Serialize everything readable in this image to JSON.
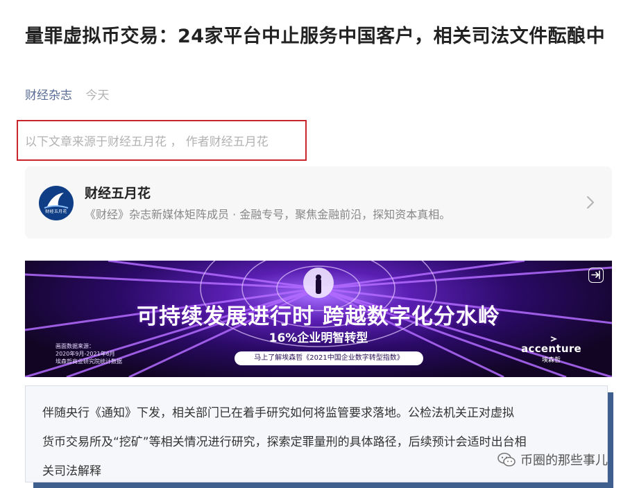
{
  "article": {
    "title": "量罪虚拟币交易：24家平台中止服务中国客户，相关司法文件酝酿中",
    "source": "财经杂志",
    "time": "今天",
    "source_note": "以下文章来源于财经五月花 ， 作者财经五月花"
  },
  "profile": {
    "avatar_text": "财经五月花",
    "name": "财经五月花",
    "description": "《财经》杂志新媒体矩阵成员 · 金融专号，聚焦金融前沿，探知资本真相。",
    "chevron_icon": "chevron-right-icon"
  },
  "banner": {
    "headline": "可持续发展进行时 跨越数字化分水岭",
    "subheadline": "16%企业明智转型",
    "cta": "马上了解埃森哲《2021中国企业数字转型指数》",
    "data_source": [
      "画面数据来源：",
      "2020年9月-2021年6月",
      "埃森哲商业研究院统计数据"
    ],
    "brand_en": "accenture",
    "brand_zh": "埃森哲",
    "exit_icon": "exit-icon",
    "colors": {
      "bg_dark": "#120524",
      "bg_mid": "#5a1fb3",
      "ray": "#b36bff"
    }
  },
  "quote": {
    "lines": [
      "伴随央行《通知》下发，相关部门已在着手研究如何将监管要求落地。公检法机关正对虚拟",
      "货币交易所及“挖矿”等相关情况进行研究，探索定罪量刑的具体路径，后续预计会适时出台相",
      "关司法解释"
    ]
  },
  "watermark": {
    "text": "币圈的那些事儿",
    "icon": "wechat-icon"
  },
  "colors": {
    "link_blue": "#576b95",
    "highlight_red": "#c9252a",
    "quote_shadow": "#3f5f8e"
  }
}
